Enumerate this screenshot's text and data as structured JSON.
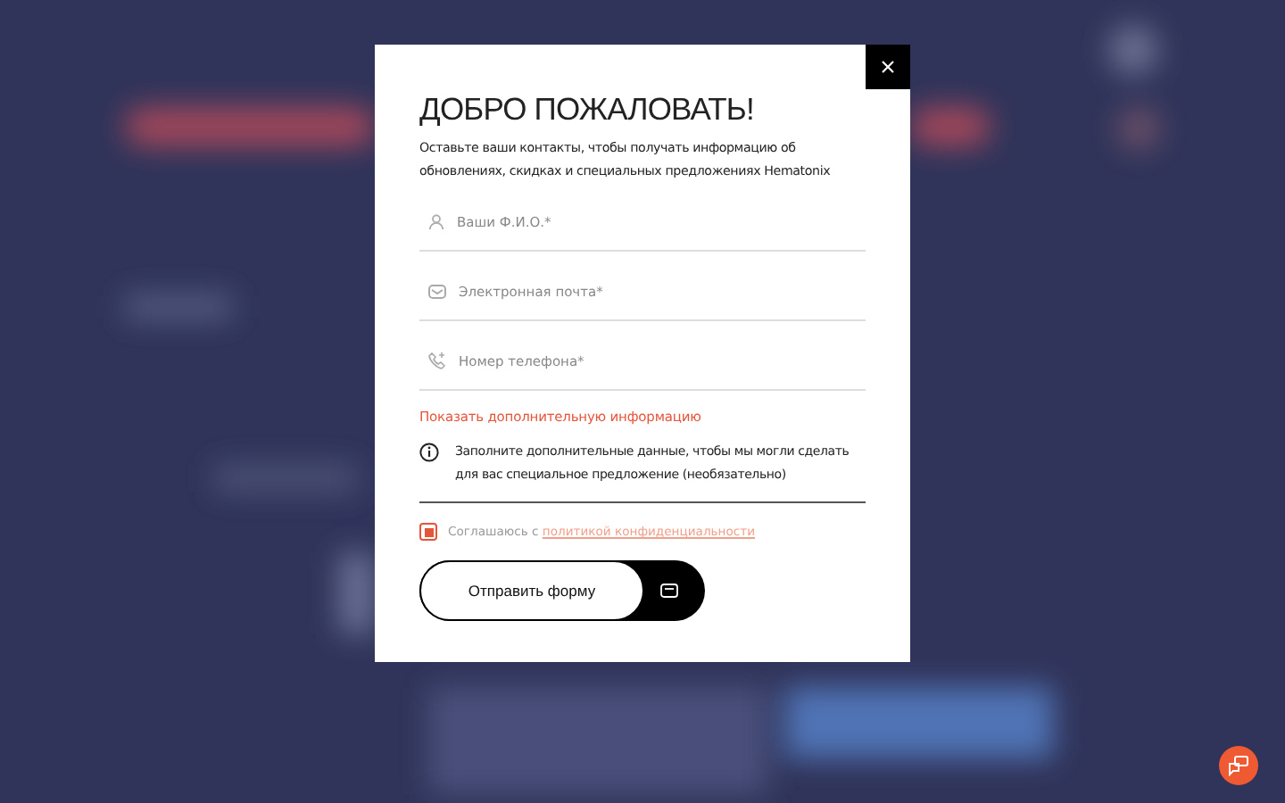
{
  "modal": {
    "title": "ДОБРО ПОЖАЛОВАТЬ!",
    "description": "Оставьте ваши контакты, чтобы получать информацию об обновлениях, скидках и специальных предложениях Hematonix",
    "fields": [
      {
        "kind": "person",
        "placeholder": "Ваши Ф.И.О.*"
      },
      {
        "kind": "email",
        "placeholder": "Электронная почта*"
      },
      {
        "kind": "phone",
        "placeholder": "Номер телефона*"
      }
    ],
    "more_link": "Показать дополнительную информацию",
    "info": "Заполните дополнительные данные, чтобы мы могли сделать для вас специальное предложение (необязательно)",
    "consent": {
      "checked": true,
      "text": "Соглашаюсь с",
      "link": "политикой конфиденциальности"
    },
    "submit": "Отправить форму"
  }
}
